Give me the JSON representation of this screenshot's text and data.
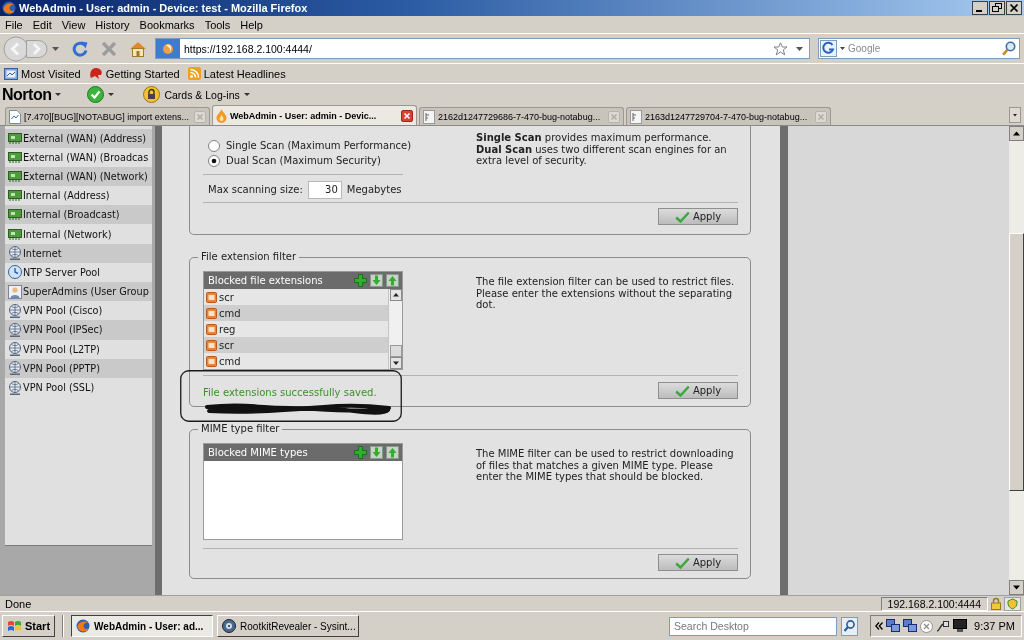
{
  "window": {
    "title": "WebAdmin - User: admin - Device: test - Mozilla Firefox"
  },
  "menu_bar": [
    "File",
    "Edit",
    "View",
    "History",
    "Bookmarks",
    "Tools",
    "Help"
  ],
  "navigation_bar": {
    "url": "https://192.168.2.100:4444/",
    "search": {
      "placeholder": "Google"
    }
  },
  "bookmarks_bar": [
    {
      "label": "Most Visited",
      "kind": "folder"
    },
    {
      "label": "Getting Started",
      "kind": "start"
    },
    {
      "label": "Latest Headlines",
      "kind": "feed"
    }
  ],
  "norton_toolbar": {
    "brand": "Norton",
    "cards_label": "Cards & Log-ins"
  },
  "tabs": [
    {
      "label": "[7.470][BUG][NOTABUG] import extens...",
      "kind": "page",
      "selected": false
    },
    {
      "label": "WebAdmin - User: admin - Devic...",
      "kind": "site",
      "selected": true
    },
    {
      "label": "2162d1247729686-7-470-bug-notabug...",
      "kind": "image",
      "selected": false
    },
    {
      "label": "2163d1247729704-7-470-bug-notabug...",
      "kind": "image",
      "selected": false
    }
  ],
  "sidebar": {
    "items": [
      {
        "label": "External (WAN) (Address)",
        "kind": "network"
      },
      {
        "label": "External (WAN) (Broadcas",
        "kind": "network"
      },
      {
        "label": "External (WAN) (Network)",
        "kind": "network"
      },
      {
        "label": "Internal (Address)",
        "kind": "network"
      },
      {
        "label": "Internal (Broadcast)",
        "kind": "network"
      },
      {
        "label": "Internal (Network)",
        "kind": "network"
      },
      {
        "label": "Internet",
        "kind": "internet"
      },
      {
        "label": "NTP Server Pool",
        "kind": "ntp"
      },
      {
        "label": "SuperAdmins (User Group",
        "kind": "group"
      },
      {
        "label": "VPN Pool (Cisco)",
        "kind": "internet"
      },
      {
        "label": "VPN Pool (IPSec)",
        "kind": "internet"
      },
      {
        "label": "VPN Pool (L2TP)",
        "kind": "internet"
      },
      {
        "label": "VPN Pool (PPTP)",
        "kind": "internet"
      },
      {
        "label": "VPN Pool (SSL)",
        "kind": "internet"
      }
    ]
  },
  "scan_section": {
    "options": [
      {
        "label": "Single Scan (Maximum Performance)",
        "selected": false
      },
      {
        "label": "Dual Scan (Maximum Security)",
        "selected": true
      }
    ],
    "max_size": {
      "label": "Max scanning size:",
      "value": "30",
      "unit": "Megabytes"
    },
    "description": "**Single Scan** provides maximum performance. **Dual Scan** uses two different scan engines for an extra level of security.",
    "apply": "Apply"
  },
  "extension_filter": {
    "legend": "File extension filter",
    "list_title": "Blocked file extensions",
    "items": [
      "scr",
      "cmd",
      "reg",
      "scr",
      "cmd"
    ],
    "description": "The file extension filter can be used to restrict files. Please enter the extensions without the separating dot.",
    "message": "File extensions successfully saved.",
    "apply": "Apply"
  },
  "mime_filter": {
    "legend": "MIME type filter",
    "list_title": "Blocked MIME types",
    "description": "The MIME filter can be used to restrict downloading of files that matches a given MIME type. Please enter the MIME types that should be blocked.",
    "apply": "Apply"
  },
  "status_bar": {
    "text": "Done",
    "host": "192.168.2.100:4444"
  },
  "taskbar": {
    "start": "Start",
    "windows": [
      {
        "label": "WebAdmin - User: ad...",
        "kind": "browser",
        "selected": true
      },
      {
        "label": "RootkitRevealer - Sysint...",
        "kind": "tool",
        "selected": false
      }
    ],
    "search": {
      "placeholder": "Search Desktop"
    },
    "clock": "9:37 PM"
  }
}
